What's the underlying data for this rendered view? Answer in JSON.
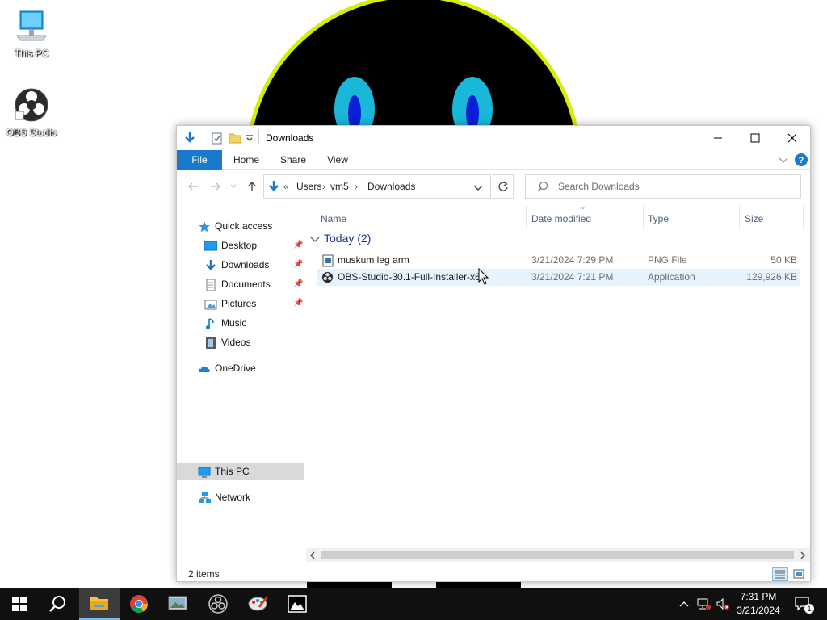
{
  "desktop": {
    "icons": [
      {
        "label": "This PC"
      },
      {
        "label": "OBS Studio"
      }
    ]
  },
  "explorer": {
    "title": "Downloads",
    "ribbon_tabs": [
      "File",
      "Home",
      "Share",
      "View"
    ],
    "breadcrumb": {
      "overflow": "«",
      "parts": [
        "Users",
        "vm5",
        "Downloads"
      ]
    },
    "search_placeholder": "Search Downloads",
    "nav": {
      "quick_access": "Quick access",
      "items": [
        "Desktop",
        "Downloads",
        "Documents",
        "Pictures",
        "Music",
        "Videos"
      ],
      "onedrive": "OneDrive",
      "this_pc": "This PC",
      "network": "Network"
    },
    "columns": [
      "Name",
      "Date modified",
      "Type",
      "Size"
    ],
    "group_label": "Today (2)",
    "files": [
      {
        "name": "muskum leg arm",
        "date": "3/21/2024 7:29 PM",
        "type": "PNG File",
        "size": "50 KB"
      },
      {
        "name": "OBS-Studio-30.1-Full-Installer-x64",
        "date": "3/21/2024 7:21 PM",
        "type": "Application",
        "size": "129,926 KB"
      }
    ],
    "status": "2 items"
  },
  "taskbar": {
    "time": "7:31 PM",
    "date": "3/21/2024",
    "notification_count": "1"
  },
  "colors": {
    "accent": "#1979ca",
    "taskbar": "#101010",
    "selection": "#e5f3ff",
    "group_text": "#1e3287"
  }
}
